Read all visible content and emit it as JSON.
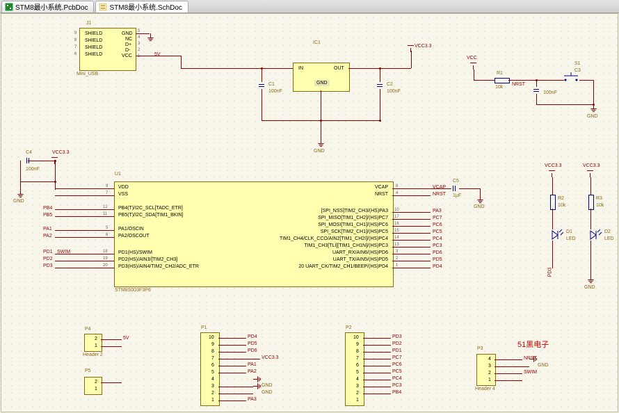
{
  "tabs": [
    {
      "icon": "pcb",
      "label": "STM8最小系统.PcbDoc",
      "active": false
    },
    {
      "icon": "sch",
      "label": "STM8最小系统.SchDoc",
      "active": true
    }
  ],
  "components": {
    "j1": {
      "ref": "J1",
      "type": "Mini_USB",
      "pins": [
        "GND",
        "NC",
        "D+",
        "D-",
        "VCC"
      ],
      "shield_label": "SHIELD",
      "pin_nums_left": [
        "9",
        "8",
        "7",
        "6"
      ],
      "pin_nums_right": [
        "5",
        "4",
        "3",
        "2",
        "1"
      ]
    },
    "ic1": {
      "ref": "IC1",
      "pins": {
        "in": "IN",
        "out": "OUT",
        "gnd": "GND"
      }
    },
    "u1": {
      "ref": "U1",
      "footprint": "STM8S003F3P6",
      "left_pins": [
        {
          "num": "9",
          "name": "VDD"
        },
        {
          "num": "7",
          "name": "VSS"
        },
        {
          "num": "12",
          "name": "PB4(T)/I2C_SCL[TADC_ETR]"
        },
        {
          "num": "11",
          "name": "PB5(T)/I2C_SDA[TIM1_BKIN]"
        },
        {
          "num": "5",
          "name": "PA1/OSCIN"
        },
        {
          "num": "6",
          "name": "PA2/OSCOUT"
        },
        {
          "num": "18",
          "name": "PD1(HS)/SWIM"
        },
        {
          "num": "19",
          "name": "PD2(HS)/AIN3/[TIM2_CH3]"
        },
        {
          "num": "20",
          "name": "PD3(HS)/AIN4/TIM2_CH2/ADC_ETR"
        }
      ],
      "right_pins": [
        {
          "num": "8",
          "name": "VCAP"
        },
        {
          "num": "4",
          "name": "NRST"
        },
        {
          "num": "10",
          "name": "[SPI_NSS]TIM2_CH3/(HS)PA3"
        },
        {
          "num": "17",
          "name": "SPI_MISO[TIM1_CH2]/(HS)PC7"
        },
        {
          "num": "16",
          "name": "SPI_MOSI[TIM1_CH1]/(HS)PC6"
        },
        {
          "num": "15",
          "name": "SPI_SCK[TIM2_CH1]/(HS)PC5"
        },
        {
          "num": "14",
          "name": "TIM1_CH4/CLK_CCO/AIN2[TIM1_CH2I]/(HS)PC4"
        },
        {
          "num": "13",
          "name": "TIM1_CH3[TLI][TIM1_CH1N]/(HS)PC3"
        },
        {
          "num": "3",
          "name": "UART_RX/AIN6/(HS)PD6"
        },
        {
          "num": "2",
          "name": "UART_TX/AIN5/(HS)PD5"
        },
        {
          "num": "1",
          "name": "20 UART_CK/TIM2_CH1/BEEP/(HS)PD4"
        }
      ]
    },
    "c1": {
      "ref": "C1",
      "val": "100nF"
    },
    "c2": {
      "ref": "C2",
      "val": "100nF"
    },
    "c3": {
      "ref": "C3",
      "val": "100nF"
    },
    "c4": {
      "ref": "C4",
      "val": "100nF"
    },
    "c5": {
      "ref": "C5",
      "val": "1µF"
    },
    "r1": {
      "ref": "R1",
      "val": "10k"
    },
    "r2": {
      "ref": "R2",
      "val": "10k"
    },
    "r3": {
      "ref": "R3",
      "val": "10k"
    },
    "s1": {
      "ref": "S1"
    },
    "d1": {
      "ref": "D1",
      "val": "LED"
    },
    "d2": {
      "ref": "D2",
      "val": "LED"
    },
    "p1": {
      "ref": "P1",
      "pin_count": 10
    },
    "p2": {
      "ref": "P2",
      "pin_count": 10
    },
    "p3": {
      "ref": "P3",
      "type": "Header 4",
      "pin_count": 4
    },
    "p4": {
      "ref": "P4",
      "type": "Header 2",
      "pin_count": 2
    },
    "p5": {
      "ref": "P5",
      "pin_count": 2
    }
  },
  "nets": {
    "vcc33": "VCC3.3",
    "vcc": "VCC",
    "v5": "5V",
    "gnd": "GND",
    "nrst": "NRST",
    "swim": "SWIM",
    "pb4": "PB4",
    "pb5": "PB5",
    "pa1": "PA1",
    "pa2": "PA2",
    "pa3": "PA3",
    "pd1": "PD1",
    "pd2": "PD2",
    "pd3": "PD3",
    "pd4": "PD4",
    "pd5": "PD5",
    "pd6": "PD6",
    "pc3": "PC3",
    "pc4": "PC4",
    "pc5": "PC5",
    "pc6": "PC6",
    "pc7": "PC7",
    "vcap": "VCAP"
  },
  "watermark": "51黑电子",
  "chart_data": null
}
